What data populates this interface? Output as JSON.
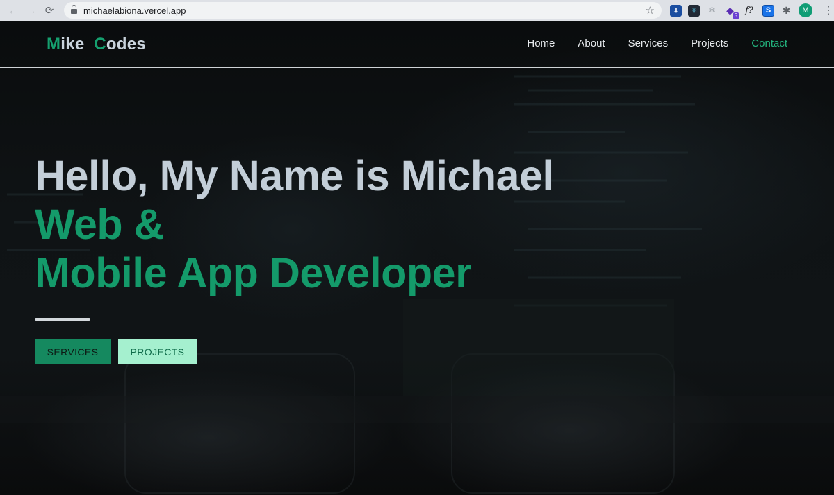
{
  "browser": {
    "url": "michaelabiona.vercel.app",
    "back_icon": "←",
    "forward_icon": "→",
    "reload_icon": "⟳",
    "star_icon": "☆",
    "extensions": [
      {
        "name": "download-extension-icon",
        "glyph": "⬇"
      },
      {
        "name": "react-devtools-icon",
        "glyph": "⚛"
      },
      {
        "name": "snowflake-extension-icon",
        "glyph": "❄"
      },
      {
        "name": "stack-extension-icon",
        "glyph": "◆",
        "badge": "5"
      },
      {
        "name": "formula-extension-icon",
        "glyph": "f?"
      },
      {
        "name": "s-extension-icon",
        "glyph": "S"
      },
      {
        "name": "puzzle-extensions-icon",
        "glyph": "✱"
      }
    ],
    "profile_initial": "M",
    "menu_icon": "⋮"
  },
  "site": {
    "logo": {
      "first_initial": "M",
      "first_rest": "ike_",
      "second_initial": "C",
      "second_rest": "odes"
    },
    "nav": [
      {
        "label": "Home",
        "active": false
      },
      {
        "label": "About",
        "active": false
      },
      {
        "label": "Services",
        "active": false
      },
      {
        "label": "Projects",
        "active": false
      },
      {
        "label": "Contact",
        "active": true
      }
    ],
    "hero": {
      "greeting": "Hello, My Name is Michael",
      "role_line1": "Web &",
      "role_line2": "Mobile App Developer"
    },
    "buttons": {
      "services": "SERVICES",
      "projects": "PROJECTS"
    }
  },
  "colors": {
    "accent": "#15a06f",
    "nav_active": "#23b37d",
    "hero_text": "#c3ced8",
    "hero_green": "#149a6a",
    "btn_services_bg": "#15895f",
    "btn_projects_bg": "#a5f0cf"
  }
}
